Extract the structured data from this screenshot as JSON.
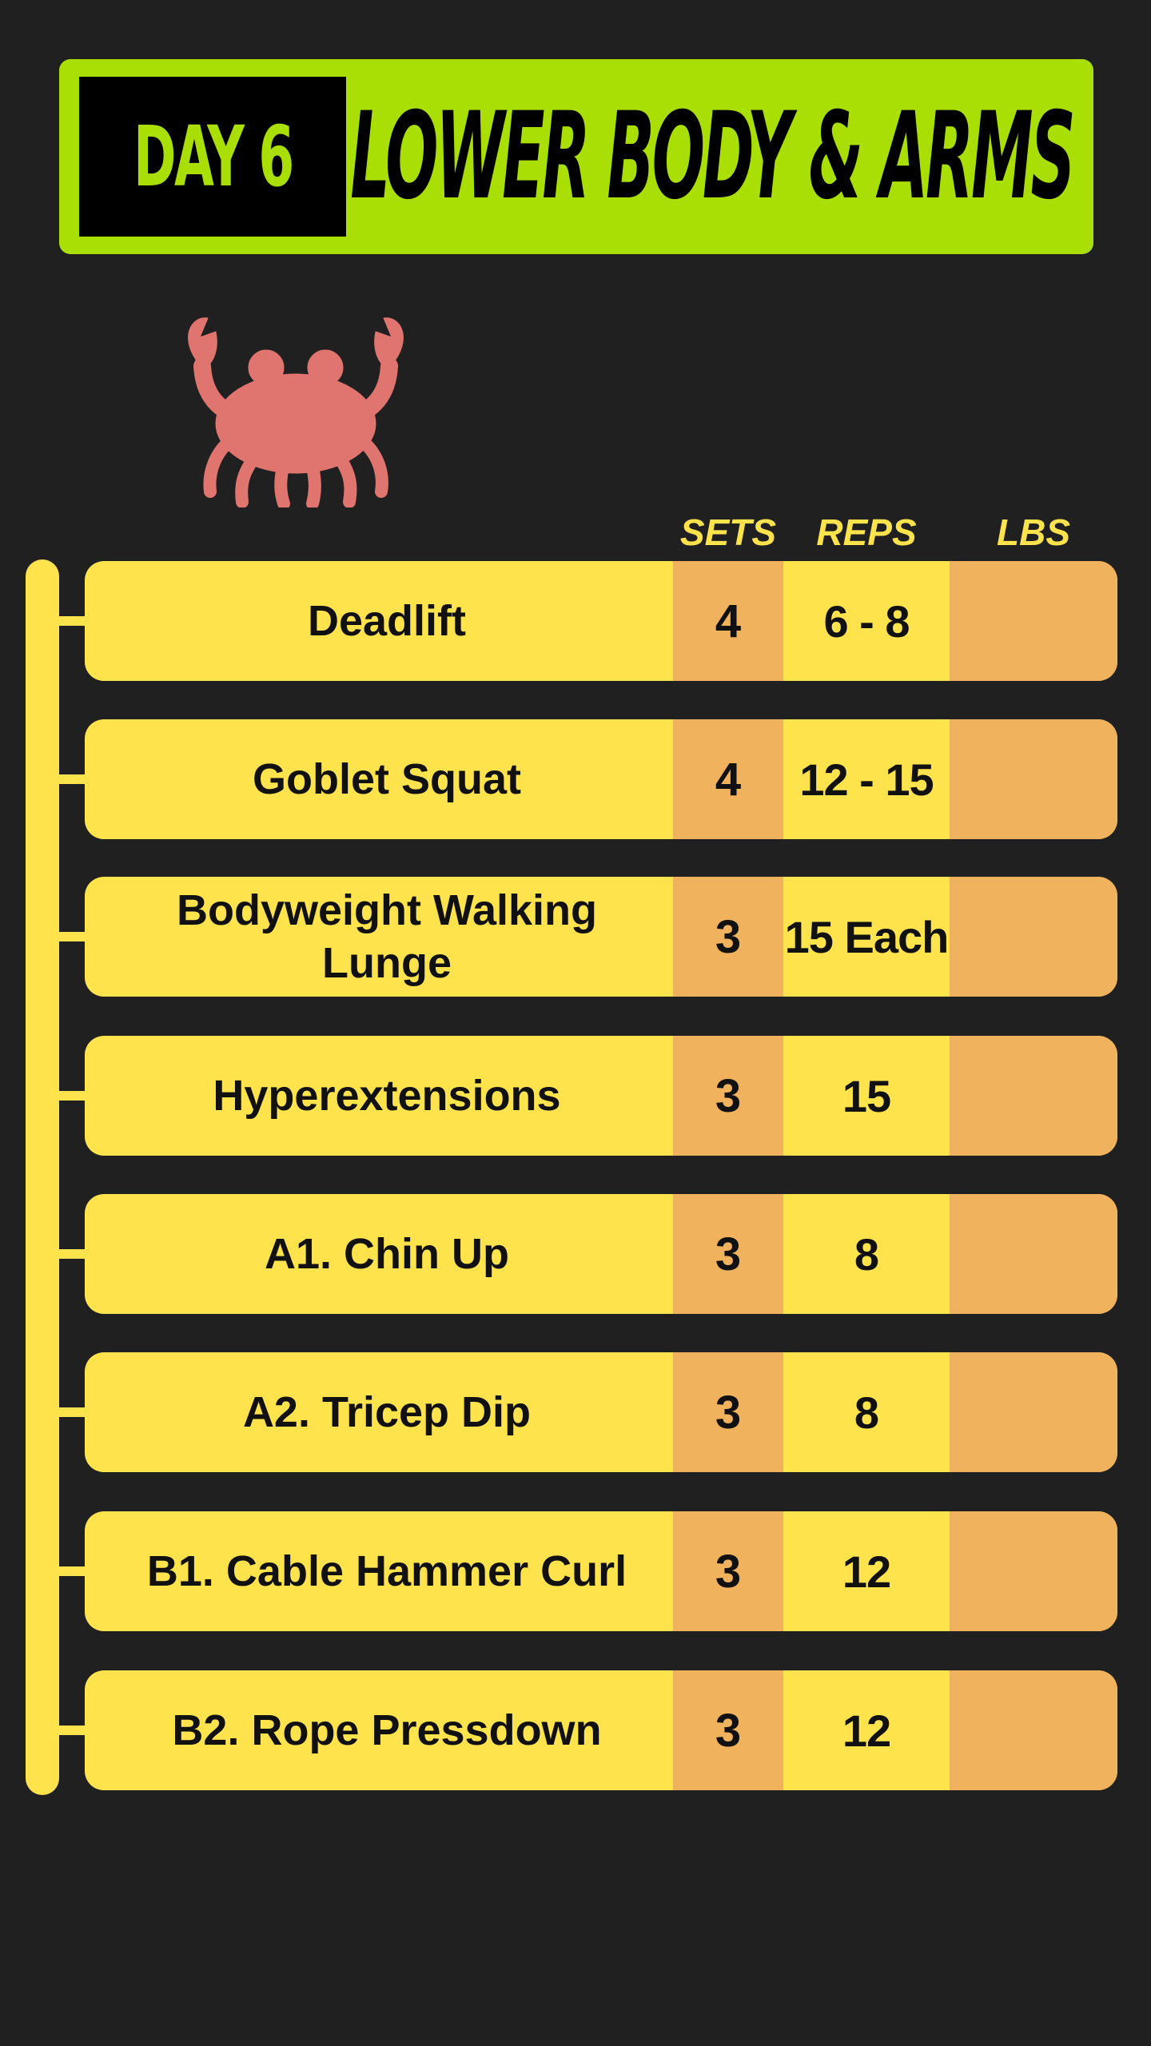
{
  "header": {
    "day_label": "DAY 6",
    "title": "LOWER BODY & ARMS"
  },
  "columns": {
    "sets": "SETS",
    "reps": "REPS",
    "lbs": "LBS"
  },
  "icons": {
    "mascot": "crab-icon"
  },
  "colors": {
    "background": "#202020",
    "header_green": "#aadf05",
    "row_yellow": "#ffe34d",
    "cell_orange": "#f0b25c",
    "crab": "#e0756f"
  },
  "exercises": [
    {
      "name": "Deadlift",
      "sets": "4",
      "reps": "6 - 8",
      "lbs": ""
    },
    {
      "name": "Goblet Squat",
      "sets": "4",
      "reps": "12 - 15",
      "lbs": ""
    },
    {
      "name": "Bodyweight Walking Lunge",
      "sets": "3",
      "reps": "15 Each",
      "lbs": ""
    },
    {
      "name": "Hyperextensions",
      "sets": "3",
      "reps": "15",
      "lbs": ""
    },
    {
      "name": "A1. Chin Up",
      "sets": "3",
      "reps": "8",
      "lbs": ""
    },
    {
      "name": "A2. Tricep Dip",
      "sets": "3",
      "reps": "8",
      "lbs": ""
    },
    {
      "name": "B1. Cable Hammer Curl",
      "sets": "3",
      "reps": "12",
      "lbs": ""
    },
    {
      "name": "B2. Rope Pressdown",
      "sets": "3",
      "reps": "12",
      "lbs": ""
    }
  ]
}
